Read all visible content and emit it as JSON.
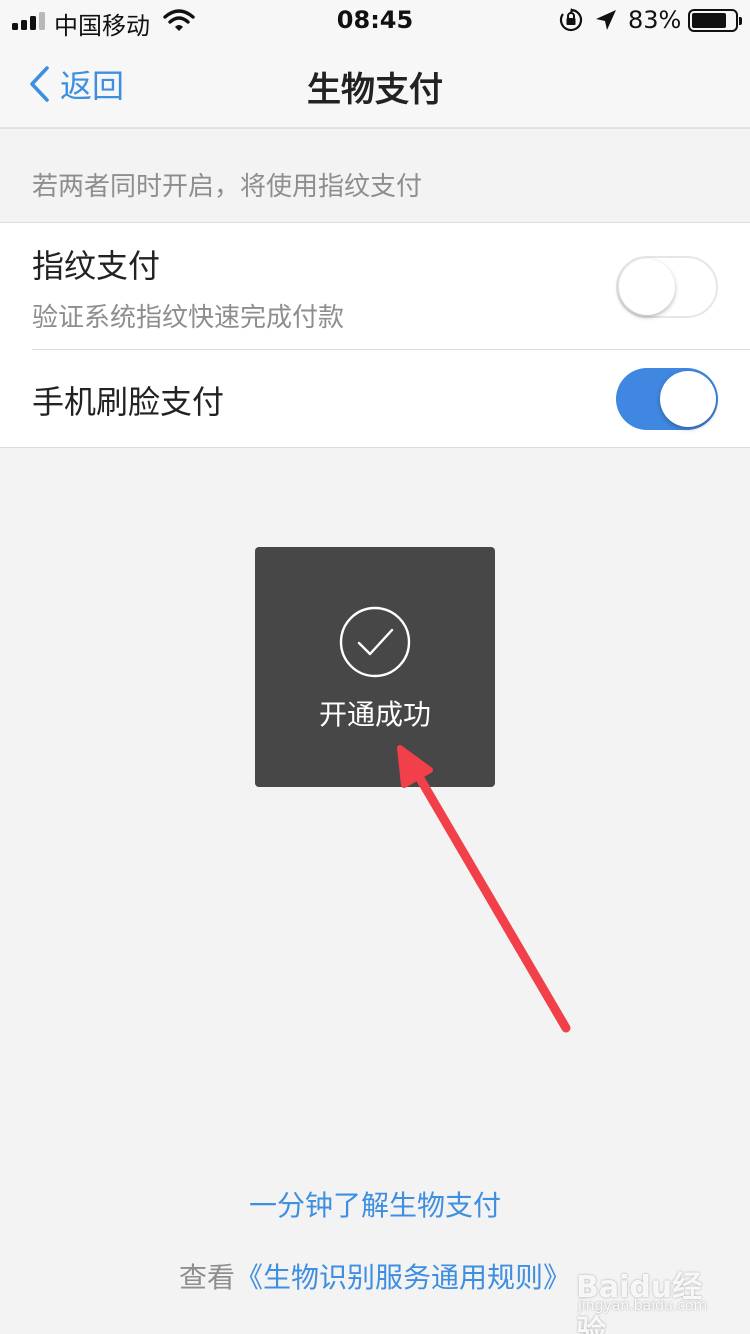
{
  "status_bar": {
    "carrier": "中国移动",
    "time": "08:45",
    "battery_percent": "83%",
    "battery_level": 0.83,
    "signal_bars": 3,
    "icons": [
      "signal-icon",
      "wifi-icon",
      "orientation-lock-icon",
      "location-arrow-icon",
      "battery-icon"
    ]
  },
  "nav": {
    "back_label": "返回",
    "title": "生物支付"
  },
  "hint": "若两者同时开启，将使用指纹支付",
  "settings": [
    {
      "title": "指纹支付",
      "subtitle": "验证系统指纹快速完成付款",
      "enabled": false
    },
    {
      "title": "手机刷脸支付",
      "enabled": true
    }
  ],
  "toast": {
    "label": "开通成功",
    "icon": "checkmark-icon"
  },
  "links": {
    "learn": "一分钟了解生物支付",
    "terms_prefix": "查看",
    "terms_link": "《生物识别服务通用规则》"
  },
  "watermark": {
    "brand": "Baidu经验",
    "url": "jingyan.baidu.com"
  },
  "colors": {
    "accent": "#3f8fe0",
    "toggle_on": "#3f87e0",
    "background": "#f3f3f3",
    "toast_bg": "#474747",
    "annotation_arrow": "#f2404a"
  }
}
